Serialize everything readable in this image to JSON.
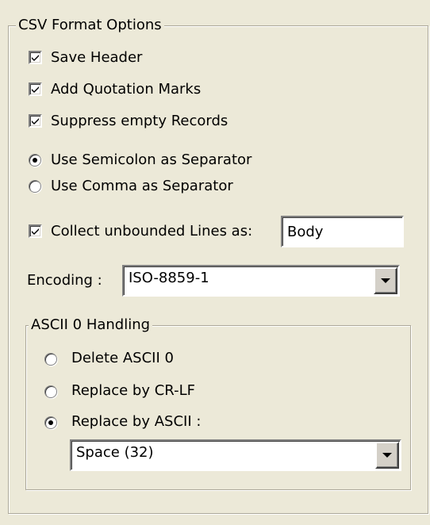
{
  "csv_group": {
    "title": "CSV Format Options",
    "save_header": {
      "label": "Save Header",
      "checked": true
    },
    "add_quotation_marks": {
      "label": "Add Quotation Marks",
      "checked": true
    },
    "suppress_empty_records": {
      "label": "Suppress empty Records",
      "checked": true
    },
    "separator": {
      "options": [
        {
          "label": "Use Semicolon as Separator",
          "selected": true
        },
        {
          "label": "Use Comma as Separator",
          "selected": false
        }
      ]
    },
    "collect_unbounded": {
      "label": "Collect unbounded Lines as:",
      "checked": true,
      "value": "Body"
    },
    "encoding": {
      "label": "Encoding :",
      "value": "ISO-8859-1"
    }
  },
  "ascii_group": {
    "title": "ASCII 0 Handling",
    "options": [
      {
        "label": "Delete ASCII 0",
        "selected": false
      },
      {
        "label": "Replace by CR-LF",
        "selected": false
      },
      {
        "label": "Replace by ASCII :",
        "selected": true
      }
    ],
    "replace_char": {
      "value": "Space (32)"
    }
  },
  "colors": {
    "background": "#ece9d8",
    "frame": "#aca899"
  }
}
